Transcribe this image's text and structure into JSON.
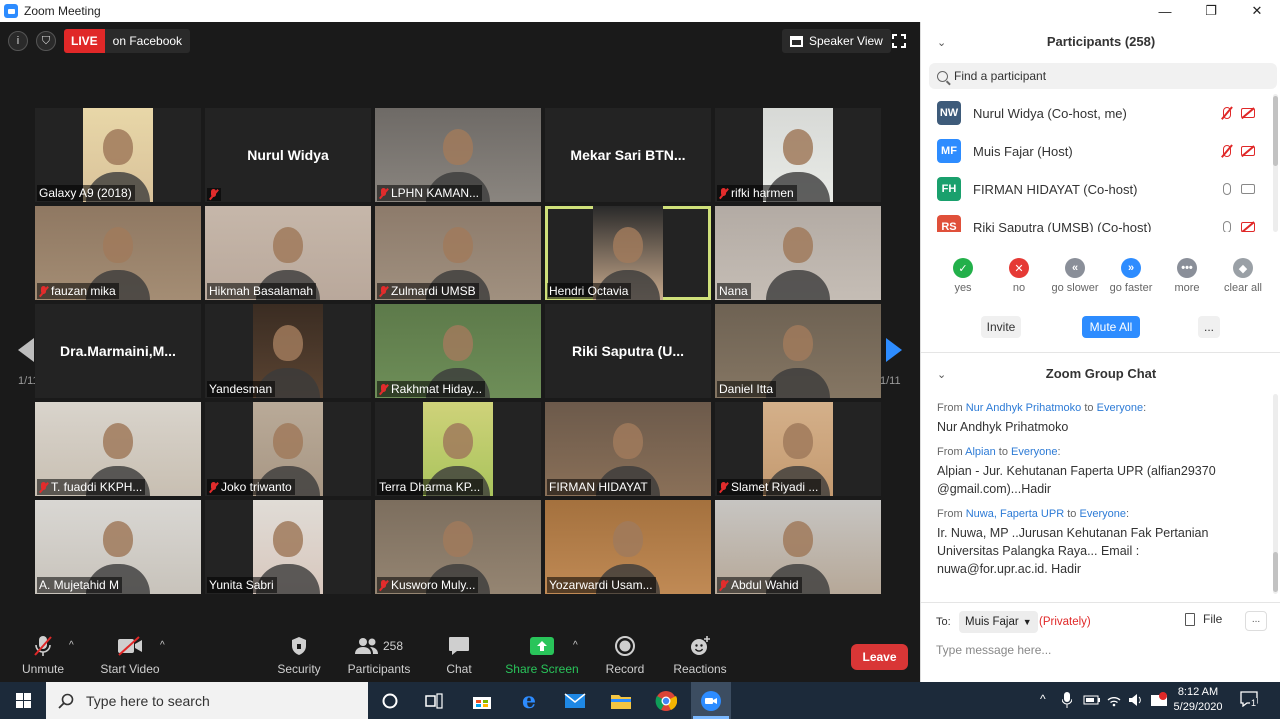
{
  "window": {
    "title": "Zoom Meeting",
    "minimize": "—",
    "maximize": "❐",
    "close": "✕"
  },
  "topbar": {
    "live_label": "LIVE",
    "live_target": "on Facebook",
    "speaker_view": "Speaker View"
  },
  "pagination": {
    "left": "1/11",
    "right": "1/11"
  },
  "tiles": [
    {
      "name": "Galaxy A9 (2018)",
      "muted": false,
      "centered": false,
      "bg": "#e8d7a8",
      "photo": "#d9c29a"
    },
    {
      "name": "Nurul Widya",
      "muted": true,
      "centered": true,
      "bg": "#232323",
      "photo": ""
    },
    {
      "name": "LPHN KAMAN...",
      "muted": true,
      "centered": false,
      "bg": "#6e6a66",
      "photo": "#8a857f"
    },
    {
      "name": "Mekar Sari BTN...",
      "muted": false,
      "centered": true,
      "bg": "#232323",
      "photo": ""
    },
    {
      "name": "rifki harmen",
      "muted": true,
      "centered": false,
      "bg": "#d7d9d6",
      "photo": "#e9ebe7"
    },
    {
      "name": "fauzan mika",
      "muted": true,
      "centered": false,
      "bg": "#8f7862",
      "photo": "#a48d74"
    },
    {
      "name": "Hikmah Basalamah",
      "muted": false,
      "centered": false,
      "bg": "#c6b7aa",
      "photo": "#b9a89b"
    },
    {
      "name": "Zulmardi UMSB",
      "muted": true,
      "centered": false,
      "bg": "#8d7b6b",
      "photo": "#a0907f"
    },
    {
      "name": "Hendri Octavia",
      "muted": false,
      "centered": false,
      "bg": "#2a2a2a",
      "photo": "#c7a98c"
    },
    {
      "name": "Nana",
      "muted": false,
      "centered": false,
      "bg": "#b3aba4",
      "photo": "#c5bdb5"
    },
    {
      "name": "Dra.Marmaini,M...",
      "muted": false,
      "centered": true,
      "bg": "#232323",
      "photo": ""
    },
    {
      "name": "Yandesman",
      "muted": false,
      "centered": false,
      "bg": "#3a2c22",
      "photo": "#5b4432"
    },
    {
      "name": "Rakhmat Hiday...",
      "muted": true,
      "centered": false,
      "bg": "#5d7a4a",
      "photo": "#6e8e58"
    },
    {
      "name": "Riki Saputra (U...",
      "muted": false,
      "centered": true,
      "bg": "#232323",
      "photo": ""
    },
    {
      "name": "Daniel Itta",
      "muted": false,
      "centered": false,
      "bg": "#6e6253",
      "photo": "#857663"
    },
    {
      "name": "T. fuaddi KKPH...",
      "muted": true,
      "centered": false,
      "bg": "#d9d4cc",
      "photo": "#c8bfb2"
    },
    {
      "name": "Joko triwanto",
      "muted": true,
      "centered": false,
      "bg": "#b9aa98",
      "photo": "#a89784"
    },
    {
      "name": "Terra Dharma KP...",
      "muted": false,
      "centered": false,
      "bg": "#cfd27a",
      "photo": "#a9c45c"
    },
    {
      "name": "FIRMAN HIDAYAT",
      "muted": false,
      "centered": false,
      "bg": "#6c5a4b",
      "photo": "#8a7058"
    },
    {
      "name": "Slamet Riyadi ...",
      "muted": true,
      "centered": false,
      "bg": "#d4b08a",
      "photo": "#c49a70"
    },
    {
      "name": "A. Mujetahid M",
      "muted": false,
      "centered": false,
      "bg": "#d9d7d3",
      "photo": "#c8c3bb"
    },
    {
      "name": "Yunita Sabri",
      "muted": false,
      "centered": false,
      "bg": "#e0dcd6",
      "photo": "#d8c7bd"
    },
    {
      "name": "Kusworo Muly...",
      "muted": true,
      "centered": false,
      "bg": "#7c6e5e",
      "photo": "#958572"
    },
    {
      "name": "Yozarwardi Usam...",
      "muted": false,
      "centered": false,
      "bg": "#a4713e",
      "photo": "#c08a55"
    },
    {
      "name": "Abdul Wahid",
      "muted": true,
      "centered": false,
      "bg": "#c7c5c2",
      "photo": "#b6a898"
    }
  ],
  "toolbar": {
    "unmute": "Unmute",
    "start_video": "Start Video",
    "security": "Security",
    "participants": "Participants",
    "participants_count": "258",
    "chat": "Chat",
    "share_screen": "Share Screen",
    "record": "Record",
    "reactions": "Reactions",
    "leave": "Leave"
  },
  "participants_panel": {
    "title": "Participants (258)",
    "search_placeholder": "Find a participant",
    "list": [
      {
        "initials": "NW",
        "name": "Nurul Widya (Co-host, me)",
        "color": "#3e5b7a",
        "mic_off": true,
        "cam_off": true
      },
      {
        "initials": "MF",
        "name": "Muis Fajar (Host)",
        "color": "#2d8cff",
        "mic_off": true,
        "cam_off": true
      },
      {
        "initials": "FH",
        "name": "FIRMAN HIDAYAT (Co-host)",
        "color": "#1aa06d",
        "mic_off": false,
        "cam_off": false
      },
      {
        "initials": "RS",
        "name": "Riki Saputra (UMSB) (Co-host)",
        "color": "#e0503a",
        "mic_off": false,
        "cam_off": true
      }
    ],
    "reactions": [
      {
        "label": "yes",
        "glyph": "✓",
        "color": "#23b04a"
      },
      {
        "label": "no",
        "glyph": "✕",
        "color": "#e53935"
      },
      {
        "label": "go slower",
        "glyph": "«",
        "color": "#8a8f99"
      },
      {
        "label": "go faster",
        "glyph": "»",
        "color": "#2d8cff"
      },
      {
        "label": "more",
        "glyph": "•••",
        "color": "#8a8f99"
      },
      {
        "label": "clear all",
        "glyph": "◆",
        "color": "#9aa0a6"
      }
    ],
    "invite": "Invite",
    "mute_all": "Mute All",
    "more": "..."
  },
  "chat_panel": {
    "title": "Zoom Group Chat",
    "messages": [
      {
        "from": "Nur Andhyk Prihatmoko",
        "to": "Everyone",
        "body": "Nur Andhyk Prihatmoko"
      },
      {
        "from": "Alpian",
        "to": "Everyone",
        "body": "Alpian - Jur. Kehutanan Faperta UPR (alfian29370\n@gmail.com)...Hadir"
      },
      {
        "from": "Nuwa, Faperta UPR",
        "to": "Everyone",
        "body": "Ir. Nuwa, MP ..Jurusan Kehutanan Fak Pertanian\nUniversitas Palangka Raya... Email :\nnuwa@for.upr.ac.id.   Hadir"
      }
    ],
    "from_word": "From",
    "to_word": "to",
    "to_label": "To:",
    "recipient": "Muis Fajar",
    "privately": "(Privately)",
    "file": "File",
    "more": "...",
    "input_placeholder": "Type message here..."
  },
  "taskbar": {
    "search_placeholder": "Type here to search",
    "time": "8:12 AM",
    "date": "5/29/2020",
    "notification_count": "1"
  }
}
